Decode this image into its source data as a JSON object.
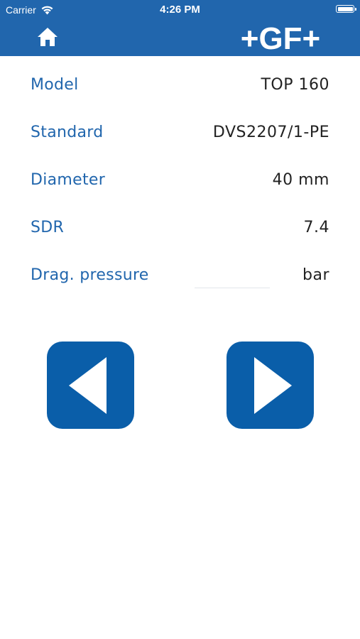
{
  "status_bar": {
    "carrier": "Carrier",
    "time": "4:26 PM"
  },
  "header": {
    "logo_text": "+GF+",
    "home_icon": "home-icon",
    "brand_color": "#2166ad"
  },
  "rows": [
    {
      "label": "Model",
      "value": "TOP 160"
    },
    {
      "label": "Standard",
      "value": "DVS2207/1-PE"
    },
    {
      "label": "Diameter",
      "value": "40 mm"
    },
    {
      "label": "SDR",
      "value": "7.4"
    },
    {
      "label": "Drag. pressure",
      "input_value": "",
      "unit": "bar"
    }
  ],
  "nav": {
    "prev_icon": "triangle-left-icon",
    "next_icon": "triangle-right-icon",
    "button_color": "#0a5ea9"
  }
}
